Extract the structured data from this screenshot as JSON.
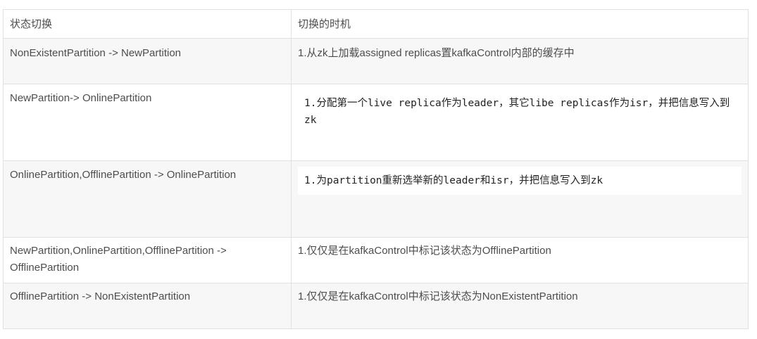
{
  "table": {
    "headers": {
      "state_change": "状态切换",
      "timing": "切换的时机"
    },
    "rows": [
      {
        "state_change": "NonExistentPartition -> NewPartition",
        "timing": "1.从zk上加载assigned replicas置kafkaControl内部的缓存中",
        "timing_is_code": false
      },
      {
        "state_change": "NewPartition-> OnlinePartition",
        "timing": "1.分配第一个live replica作为leader，其它libe replicas作为isr，并把信息写入到zk",
        "timing_is_code": true
      },
      {
        "state_change": "OnlinePartition,OfflinePartition -> OnlinePartition",
        "timing": "1.为partition重新选举新的leader和isr，并把信息写入到zk",
        "timing_is_code": true
      },
      {
        "state_change": "NewPartition,OnlinePartition,OfflinePartition -> OfflinePartition",
        "timing": "1.仅仅是在kafkaControl中标记该状态为OfflinePartition",
        "timing_is_code": false
      },
      {
        "state_change": "OfflinePartition -> NonExistentPartition",
        "timing": "1.仅仅是在kafkaControl中标记该状态为NonExistentPartition",
        "timing_is_code": false
      }
    ]
  },
  "colors": {
    "border": "#e1e1e1",
    "row_alt_bg": "#f7f7f7",
    "text": "#4d4d4d",
    "code_bg": "#ffffff"
  }
}
